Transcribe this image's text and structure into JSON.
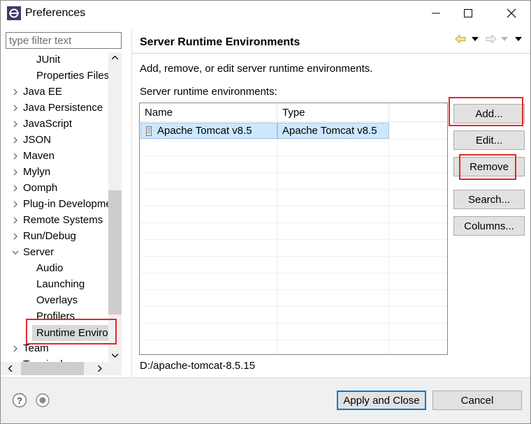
{
  "window": {
    "title": "Preferences"
  },
  "filter": {
    "placeholder": "type filter text",
    "value": ""
  },
  "tree": [
    {
      "label": "JUnit",
      "indent": 1,
      "expander": "none"
    },
    {
      "label": "Properties Files",
      "indent": 1,
      "expander": "none"
    },
    {
      "label": "Java EE",
      "indent": 0,
      "expander": "collapsed"
    },
    {
      "label": "Java Persistence",
      "indent": 0,
      "expander": "collapsed"
    },
    {
      "label": "JavaScript",
      "indent": 0,
      "expander": "collapsed"
    },
    {
      "label": "JSON",
      "indent": 0,
      "expander": "collapsed"
    },
    {
      "label": "Maven",
      "indent": 0,
      "expander": "collapsed"
    },
    {
      "label": "Mylyn",
      "indent": 0,
      "expander": "collapsed"
    },
    {
      "label": "Oomph",
      "indent": 0,
      "expander": "collapsed"
    },
    {
      "label": "Plug-in Development",
      "indent": 0,
      "expander": "collapsed"
    },
    {
      "label": "Remote Systems",
      "indent": 0,
      "expander": "collapsed"
    },
    {
      "label": "Run/Debug",
      "indent": 0,
      "expander": "collapsed"
    },
    {
      "label": "Server",
      "indent": 0,
      "expander": "expanded"
    },
    {
      "label": "Audio",
      "indent": 1,
      "expander": "none"
    },
    {
      "label": "Launching",
      "indent": 1,
      "expander": "none"
    },
    {
      "label": "Overlays",
      "indent": 1,
      "expander": "none"
    },
    {
      "label": "Profilers",
      "indent": 1,
      "expander": "none"
    },
    {
      "label": "Runtime Environments",
      "indent": 1,
      "expander": "none",
      "selected": true
    },
    {
      "label": "Team",
      "indent": 0,
      "expander": "collapsed"
    },
    {
      "label": "Terminal",
      "indent": 0,
      "expander": "collapsed"
    }
  ],
  "page": {
    "title": "Server Runtime Environments",
    "description": "Add, remove, or edit server runtime environments.",
    "list_label": "Server runtime environments:",
    "columns": [
      "Name",
      "Type"
    ],
    "rows": [
      {
        "checked": false,
        "name": "Apache Tomcat v8.5",
        "type": "Apache Tomcat v8.5",
        "selected": true
      }
    ],
    "path": "D:/apache-tomcat-8.5.15"
  },
  "buttons": {
    "add": "Add...",
    "edit": "Edit...",
    "remove": "Remove",
    "search": "Search...",
    "columns": "Columns..."
  },
  "footer": {
    "apply_close": "Apply and Close",
    "cancel": "Cancel"
  },
  "icons": {
    "app": "eclipse-icon",
    "back": "back-arrow-icon",
    "forward": "forward-arrow-icon",
    "help": "help-icon",
    "record": "record-icon"
  },
  "colors": {
    "highlight_box": "#e0292b",
    "selection": "#cce8ff",
    "primary_border": "#0078d7"
  }
}
